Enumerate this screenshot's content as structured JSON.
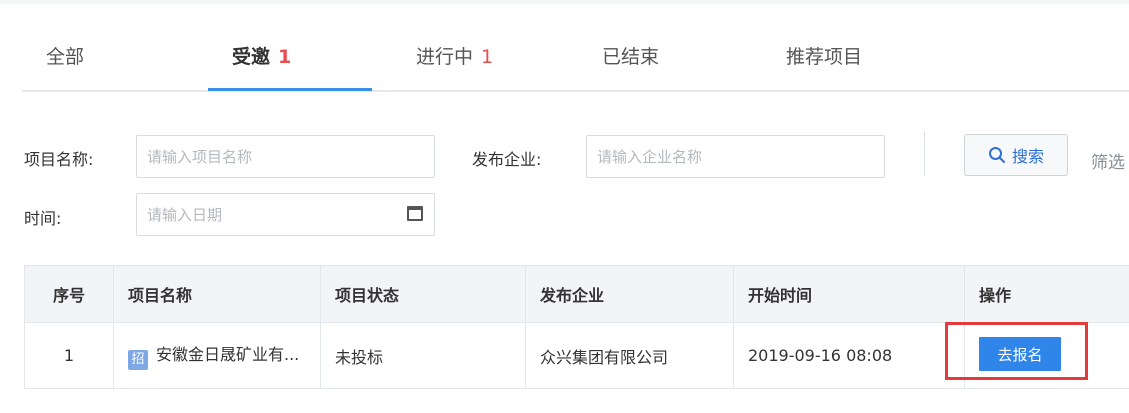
{
  "tabs": [
    {
      "label": "全部",
      "count": ""
    },
    {
      "label": "受邀",
      "count": "1"
    },
    {
      "label": "进行中",
      "count": "1"
    },
    {
      "label": "已结束",
      "count": ""
    },
    {
      "label": "推荐项目",
      "count": ""
    }
  ],
  "active_tab": "受邀",
  "filters": {
    "project_name_label": "项目名称:",
    "project_name_placeholder": "请输入项目名称",
    "company_label": "发布企业:",
    "company_placeholder": "请输入企业名称",
    "time_label": "时间:",
    "time_placeholder": "请输入日期",
    "search_label": "搜索",
    "filter_label": "筛选"
  },
  "table": {
    "headers": [
      "序号",
      "项目名称",
      "项目状态",
      "发布企业",
      "开始时间",
      "操作"
    ],
    "rows": [
      {
        "seq": "1",
        "badge": "招",
        "name": "安徽金日晟矿业有...",
        "status": "未投标",
        "company": "众兴集团有限公司",
        "start_time": "2019-09-16 08:08",
        "action": "去报名"
      }
    ]
  },
  "colors": {
    "accent": "#3a8ee6",
    "count": "#e84d4d",
    "action_button": "#2f86e8",
    "highlight": "#e23b3b"
  }
}
